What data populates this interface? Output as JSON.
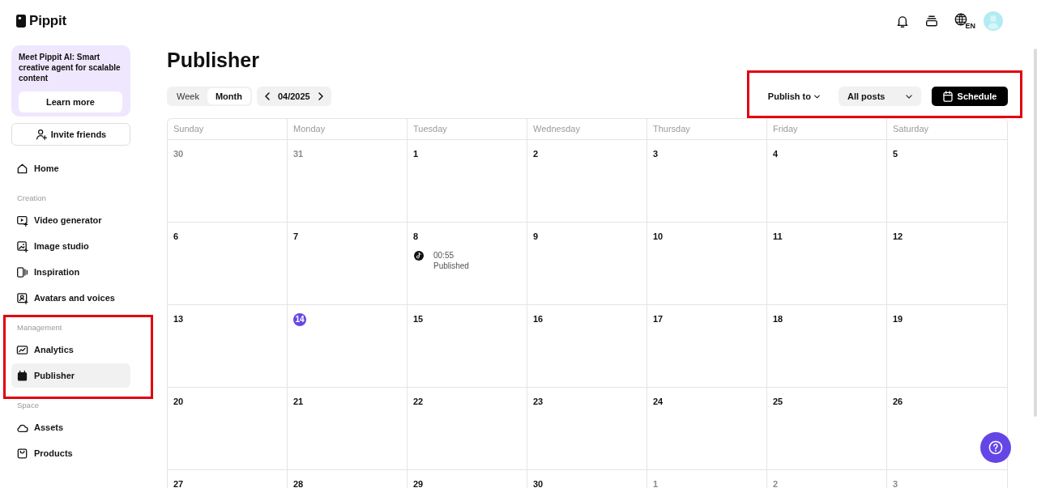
{
  "brand": {
    "name": "Pippit"
  },
  "header": {
    "language": "EN"
  },
  "sidebar": {
    "promo": {
      "text": "Meet Pippit AI: Smart creative agent for scalable content",
      "button": "Learn more"
    },
    "invite_button": "Invite friends",
    "sections": [
      {
        "highlighted": false,
        "items": [
          {
            "label": "Home",
            "selected": false
          }
        ]
      },
      {
        "label": "Creation",
        "highlighted": false,
        "items": [
          {
            "label": "Video generator",
            "selected": false
          },
          {
            "label": "Image studio",
            "selected": false
          },
          {
            "label": "Inspiration",
            "selected": false
          },
          {
            "label": "Avatars and voices",
            "selected": false
          }
        ]
      },
      {
        "label": "Management",
        "highlighted": true,
        "items": [
          {
            "label": "Analytics",
            "selected": false
          },
          {
            "label": "Publisher",
            "selected": true
          }
        ]
      },
      {
        "label": "Space",
        "highlighted": false,
        "items": [
          {
            "label": "Assets",
            "selected": false
          },
          {
            "label": "Products",
            "selected": false
          }
        ]
      }
    ]
  },
  "page": {
    "title": "Publisher"
  },
  "view_toggle": [
    {
      "label": "Week",
      "selected": false
    },
    {
      "label": "Month",
      "selected": true
    }
  ],
  "period": {
    "label": "04/2025"
  },
  "toolbar": {
    "highlighted": true,
    "publish_to": "Publish to",
    "filter": "All posts",
    "schedule_button": "Schedule"
  },
  "calendar": {
    "weekdays": [
      "Sunday",
      "Monday",
      "Tuesday",
      "Wednesday",
      "Thursday",
      "Friday",
      "Saturday"
    ],
    "weeks": [
      [
        {
          "day": "30",
          "in_month": false,
          "today": false
        },
        {
          "day": "31",
          "in_month": false,
          "today": false
        },
        {
          "day": "1",
          "in_month": true,
          "today": false
        },
        {
          "day": "2",
          "in_month": true,
          "today": false
        },
        {
          "day": "3",
          "in_month": true,
          "today": false
        },
        {
          "day": "4",
          "in_month": true,
          "today": false
        },
        {
          "day": "5",
          "in_month": true,
          "today": false
        }
      ],
      [
        {
          "day": "6",
          "in_month": true,
          "today": false
        },
        {
          "day": "7",
          "in_month": true,
          "today": false
        },
        {
          "day": "8",
          "in_month": true,
          "today": false,
          "events": [
            {
              "time": "00:55",
              "status": "Published"
            }
          ]
        },
        {
          "day": "9",
          "in_month": true,
          "today": false
        },
        {
          "day": "10",
          "in_month": true,
          "today": false
        },
        {
          "day": "11",
          "in_month": true,
          "today": false
        },
        {
          "day": "12",
          "in_month": true,
          "today": false
        }
      ],
      [
        {
          "day": "13",
          "in_month": true,
          "today": false
        },
        {
          "day": "14",
          "in_month": true,
          "today": true
        },
        {
          "day": "15",
          "in_month": true,
          "today": false
        },
        {
          "day": "16",
          "in_month": true,
          "today": false
        },
        {
          "day": "17",
          "in_month": true,
          "today": false
        },
        {
          "day": "18",
          "in_month": true,
          "today": false
        },
        {
          "day": "19",
          "in_month": true,
          "today": false
        }
      ],
      [
        {
          "day": "20",
          "in_month": true,
          "today": false
        },
        {
          "day": "21",
          "in_month": true,
          "today": false
        },
        {
          "day": "22",
          "in_month": true,
          "today": false
        },
        {
          "day": "23",
          "in_month": true,
          "today": false
        },
        {
          "day": "24",
          "in_month": true,
          "today": false
        },
        {
          "day": "25",
          "in_month": true,
          "today": false
        },
        {
          "day": "26",
          "in_month": true,
          "today": false
        }
      ],
      [
        {
          "day": "27",
          "in_month": true,
          "today": false
        },
        {
          "day": "28",
          "in_month": true,
          "today": false
        },
        {
          "day": "29",
          "in_month": true,
          "today": false
        },
        {
          "day": "30",
          "in_month": true,
          "today": false
        },
        {
          "day": "1",
          "in_month": false,
          "today": false
        },
        {
          "day": "2",
          "in_month": false,
          "today": false
        },
        {
          "day": "3",
          "in_month": false,
          "today": false
        }
      ]
    ]
  }
}
